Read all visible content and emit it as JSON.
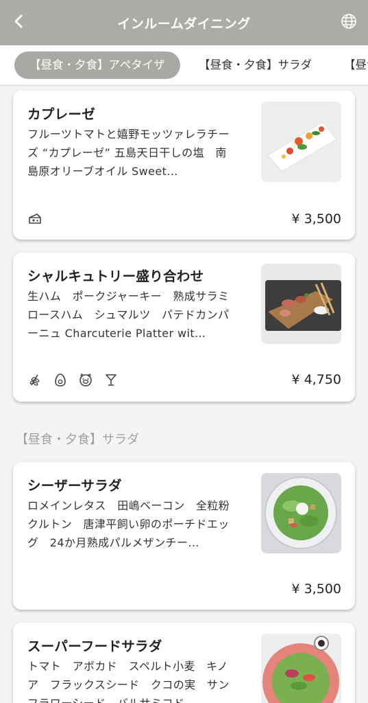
{
  "header": {
    "title": "インルームダイニング",
    "back_icon": "chevron-left-icon",
    "lang_icon": "globe-icon"
  },
  "tabs": [
    {
      "label": "【昼食・夕食】アペタイザ",
      "active": true
    },
    {
      "label": "【昼食・夕食】サラダ",
      "active": false
    },
    {
      "label": "【昼食",
      "active": false
    }
  ],
  "items": [
    {
      "name": "カプレーゼ",
      "desc": "フルーツトマトと嬉野モッツァレラチーズ “カプレーゼ” 五島天日干しの塩　南島原オリーブオイル Sweet…",
      "price": "¥ 3,500",
      "icons": [
        "cheese-icon"
      ]
    },
    {
      "name": "シャルキュトリー盛り合わせ",
      "desc": "生ハム　ポークジャーキー　熟成サラミ　ロースハム　シュマルツ　パテドカンパーニュ Charcuterie Platter wit…",
      "price": "¥ 4,750",
      "icons": [
        "wheat-icon",
        "egg-icon",
        "pig-icon",
        "cocktail-icon"
      ]
    },
    {
      "name": "シーザーサラダ",
      "desc": "ロメインレタス　田嶋ベーコン　全粒粉クルトン　唐津平飼い卵のポーチドエッグ　24か月熟成パルメザンチー…",
      "price": "¥ 3,500",
      "icons": []
    },
    {
      "name": "スーパーフードサラダ",
      "desc": "トマト　アボカド　スペルト小麦　キノア　フラックスシード　クコの実　サンフラワーシード　バルサミコド",
      "price": "",
      "icons": []
    }
  ],
  "section_salad": "【昼食・夕食】サラダ",
  "colors": {
    "header_bg": "#acaca6",
    "active_tab": "#a8a8a4",
    "page_bg": "#f4f4f4"
  }
}
